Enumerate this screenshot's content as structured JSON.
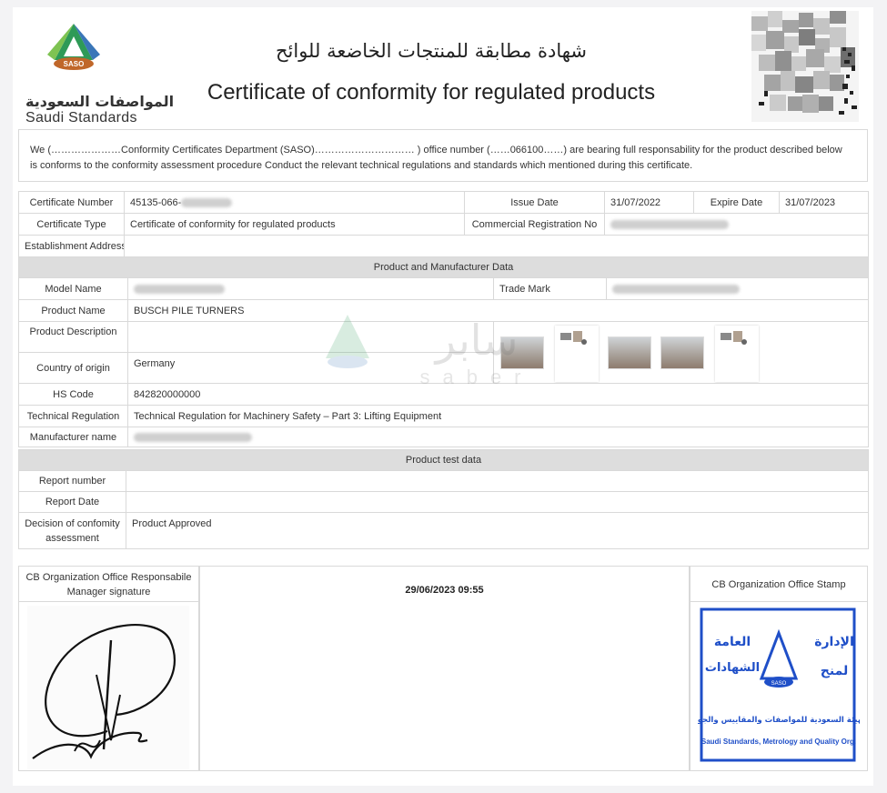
{
  "header": {
    "logo_badge": "SASO",
    "logo_ar": "المواصفات السعودية",
    "logo_en": "Saudi Standards",
    "title_ar": "شهادة مطابقة للمنتجات الخاضعة للوائح",
    "title_en": "Certificate of conformity for regulated products"
  },
  "intro": {
    "line1": "We (…………………Conformity Certificates Department (SASO)………………………… ) office number (……066100……) are bearing full responsability for the product described below",
    "line2": "is conforms to the conformity assessment procedure Conduct the relevant technical regulations and standards which mentioned during this certificate."
  },
  "certificate": {
    "number_label": "Certificate Number",
    "number_value": "45135-066-",
    "issue_label": "Issue Date",
    "issue_value": "31/07/2022",
    "expire_label": "Expire Date",
    "expire_value": "31/07/2023",
    "type_label": "Certificate Type",
    "type_value": "Certificate of conformity for regulated products",
    "cr_label": "Commercial Registration No",
    "address_label": "Establishment Address"
  },
  "product": {
    "section_title": "Product and Manufacturer Data",
    "model_label": "Model Name",
    "trademark_label": "Trade Mark",
    "name_label": "Product Name",
    "name_value": "BUSCH PILE TURNERS",
    "description_label": "Product Description",
    "origin_label": "Country of origin",
    "origin_value": "Germany",
    "hs_label": "HS Code",
    "hs_value": "842820000000",
    "regulation_label": "Technical Regulation",
    "regulation_value": "Technical Regulation for Machinery Safety – Part 3: Lifting Equipment",
    "manufacturer_label": "Manufacturer name"
  },
  "test": {
    "section_title": "Product test data",
    "report_number_label": "Report number",
    "report_date_label": "Report Date",
    "decision_label_1": "Decision of confomity",
    "decision_label_2": "assessment",
    "decision_value": "Product Approved"
  },
  "footer": {
    "signature_label_1": "CB Organization Office Responsabile",
    "signature_label_2": "Manager signature",
    "datetime": "29/06/2023 09:55",
    "stamp_label": "CB Organization Office Stamp",
    "stamp_ar_1": "الإدارة",
    "stamp_ar_2": "العامة",
    "stamp_ar_3": "لمنح",
    "stamp_ar_4": "الشهادات",
    "stamp_ar_5": "الهيئة السعودية للمواصفات والمقاييس والجودة",
    "stamp_en": "Saudi Standards, Metrology and Quality Org.",
    "stamp_badge": "SASO"
  },
  "watermark": {
    "ar": "سابر",
    "en": "saber"
  },
  "colors": {
    "section_bg": "#dddddd",
    "border": "#d9d9d9",
    "stamp_blue": "#1f4fc8",
    "logo_teal": "#2a9a8a",
    "logo_orange": "#e07b2a"
  }
}
